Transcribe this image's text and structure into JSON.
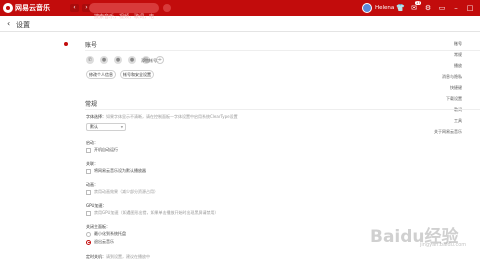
{
  "app": {
    "name": "网易云音乐",
    "brand_color": "#c20c0c"
  },
  "topbar": {
    "nav_back_icon": "chevron-left-icon",
    "nav_forward_icon": "chevron-right-icon",
    "search_placeholder": "搜索音乐，视频，歌词，电台",
    "username": "Helena",
    "message_badge": "17"
  },
  "header": {
    "back_glyph": "‹",
    "title": "设置"
  },
  "sidebar": {
    "items": [
      {
        "label": "账号",
        "active": true
      },
      {
        "label": "常规"
      },
      {
        "label": "播放"
      },
      {
        "label": "消息与隐私"
      },
      {
        "label": "快捷键"
      },
      {
        "label": "下载设置"
      },
      {
        "label": "歌词"
      },
      {
        "label": "工具"
      },
      {
        "label": "关于网易云音乐"
      }
    ]
  },
  "account": {
    "title": "账号",
    "add_label": "添加帐号：",
    "edit_profile_button": "修改个人信息",
    "bind_button": "帐号和安全设置"
  },
  "general": {
    "title": "常规",
    "font_label": "字体选择：",
    "font_note": "如果字体显示不清晰，请在控制面板—字体设置中启用系统ClearType设置",
    "font_value": "默认",
    "startup_label": "启动：",
    "startup_option": "开机自动运行",
    "assoc_label": "关联：",
    "assoc_option": "将网易云音乐设为默认播放器",
    "animation_label": "动画：",
    "animation_option": "禁用动画效果（减少部分资源占用）",
    "gpu_label": "GPU加速：",
    "gpu_option": "禁用GPU加速（如遇图形出错，如果单击播放开始时出现黑屏请禁用）",
    "close_label": "关闭主面板：",
    "close_option_1": "最小化到系统托盘",
    "close_option_2": "退出云音乐",
    "timed_label": "定时关机：",
    "timed_note": "请到设置，建议在播放中"
  },
  "watermark": {
    "text": "Baidu经验",
    "sub": "jingyan.baidu.com"
  }
}
